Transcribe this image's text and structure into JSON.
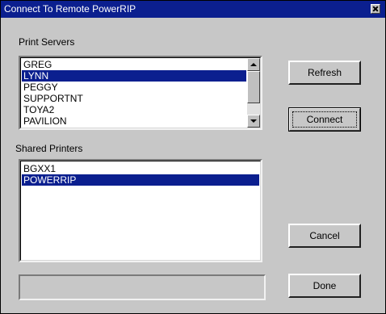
{
  "window": {
    "title": "Connect To  Remote PowerRIP"
  },
  "print_servers": {
    "label": "Print Servers",
    "items": [
      "GREG",
      "LYNN",
      "PEGGY",
      "SUPPORTNT",
      "TOYA2",
      "PAVILION"
    ],
    "selected": "LYNN"
  },
  "shared_printers": {
    "label": "Shared Printers",
    "items": [
      "BGXX1",
      "POWERRIP"
    ],
    "selected": "POWERRIP"
  },
  "buttons": {
    "refresh": "Refresh",
    "connect": "Connect",
    "cancel": "Cancel",
    "done": "Done"
  },
  "status": {
    "text": ""
  },
  "colors": {
    "selection": "#0b1f8f",
    "titlebar": "#0b1f8f",
    "background": "#c7c7c7"
  }
}
